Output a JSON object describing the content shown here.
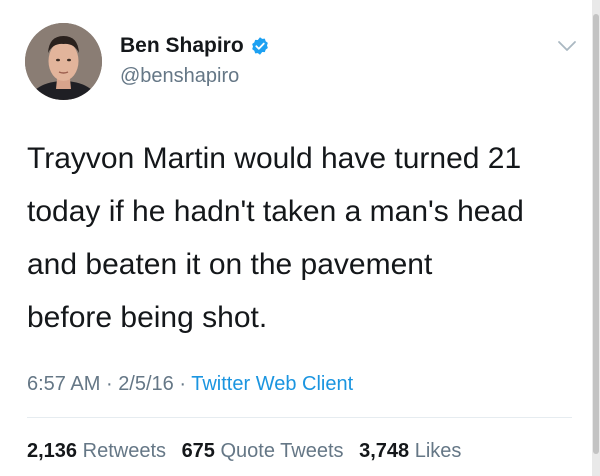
{
  "user": {
    "display_name": "Ben Shapiro",
    "handle": "@benshapiro",
    "verified_icon": "verified-badge-icon",
    "avatar": "profile-photo"
  },
  "tweet": {
    "lines": [
      "Trayvon Martin would have turned 21",
      "today if he hadn't taken a man's head",
      "and beaten it on the pavement",
      "before being shot."
    ]
  },
  "meta": {
    "time": "6:57 AM",
    "separator": "·",
    "date": "2/5/16",
    "source": "Twitter Web Client"
  },
  "stats": {
    "retweets": {
      "count": "2,136",
      "label": "Retweets"
    },
    "quote_tweets": {
      "count": "675",
      "label": "Quote Tweets"
    },
    "likes": {
      "count": "3,748",
      "label": "Likes"
    }
  },
  "colors": {
    "text": "#14171a",
    "secondary": "#657786",
    "link": "#1b95e0",
    "verified": "#1da1f2"
  }
}
